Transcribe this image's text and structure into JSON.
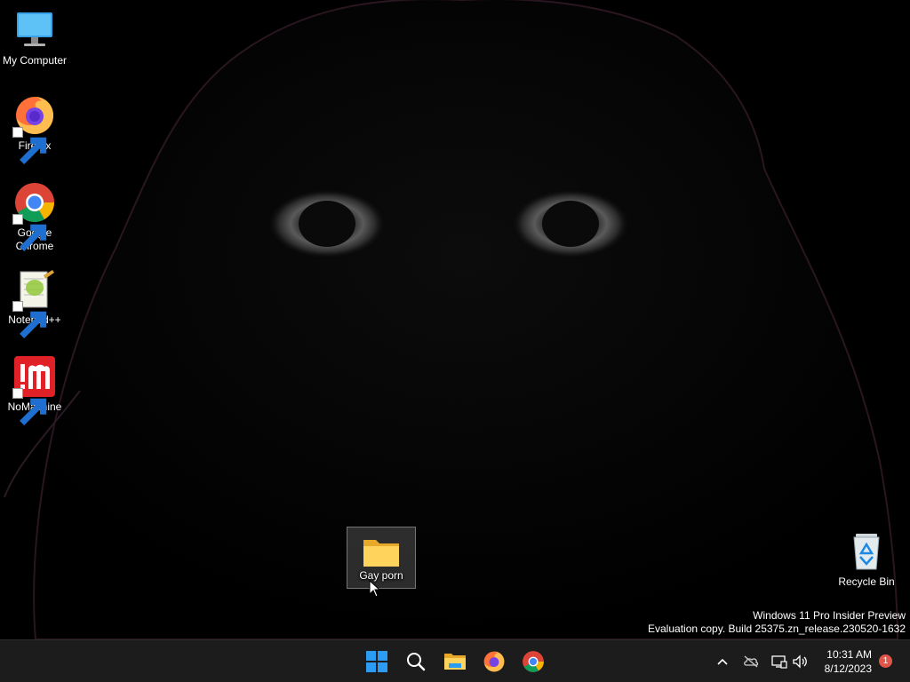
{
  "desktop": {
    "icons": [
      {
        "label": "My Computer",
        "icon": "computer-icon"
      },
      {
        "label": "Firefox",
        "icon": "firefox-icon"
      },
      {
        "label": "Google Chrome",
        "icon": "chrome-icon"
      },
      {
        "label": "Notepad++",
        "icon": "notepadpp-icon"
      },
      {
        "label": "NoMachine",
        "icon": "nomachine-icon"
      }
    ],
    "folder": {
      "label": "Gay porn",
      "icon": "folder-icon"
    },
    "recycle_bin": {
      "label": "Recycle Bin",
      "icon": "recycle-bin-icon"
    }
  },
  "watermark": {
    "line1": "Windows 11 Pro Insider Preview",
    "line2": "Evaluation copy. Build 25375.zn_release.230520-1632"
  },
  "taskbar": {
    "apps": [
      {
        "name": "Start",
        "icon": "windows-start-icon"
      },
      {
        "name": "Search",
        "icon": "search-icon"
      },
      {
        "name": "File Explorer",
        "icon": "file-explorer-icon"
      },
      {
        "name": "Firefox",
        "icon": "firefox-icon"
      },
      {
        "name": "Google Chrome",
        "icon": "chrome-icon"
      }
    ],
    "tray": {
      "icons": [
        "chevron-up-icon",
        "onedrive-offline-icon",
        "network-icon",
        "volume-icon"
      ],
      "time": "10:31 AM",
      "date": "8/12/2023",
      "notification_count": "1"
    }
  },
  "colors": {
    "taskbar_bg": "#1c1c1c",
    "accent": "#0078d4",
    "notification": "#e0564a"
  }
}
